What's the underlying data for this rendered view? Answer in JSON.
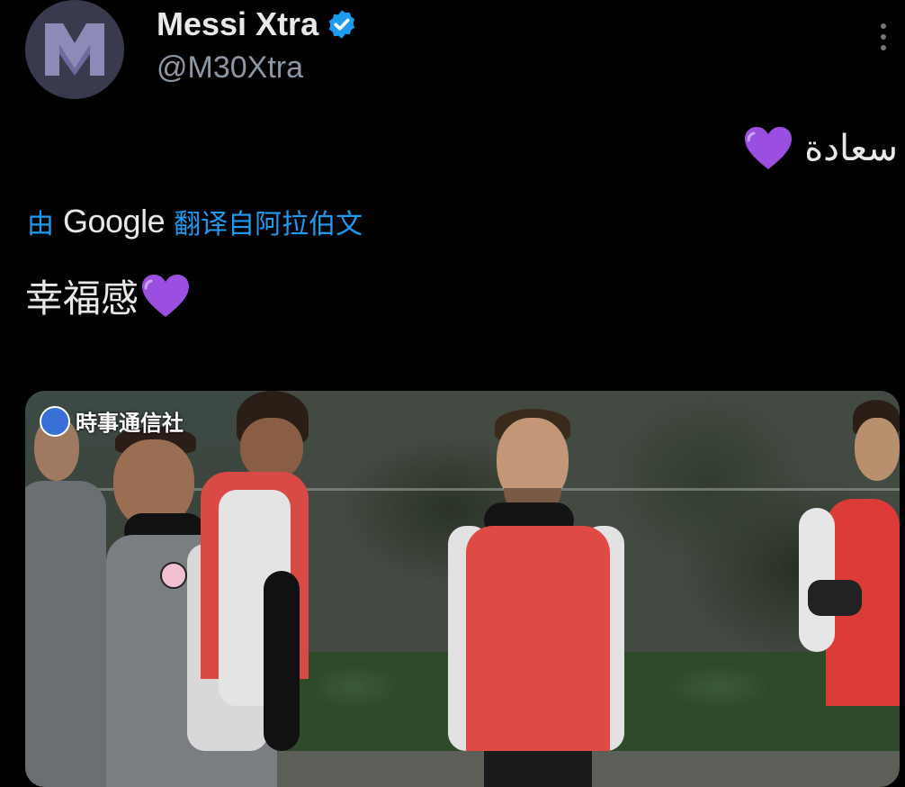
{
  "tweet": {
    "display_name": "Messi Xtra",
    "handle": "@M30Xtra",
    "original_text": "سعادة",
    "translate_prefix": "由",
    "translate_brand": "Google",
    "translate_suffix": "翻译自阿拉伯文",
    "translated_text": "幸福感",
    "icons": {
      "avatar": "m-logo-avatar",
      "verified": "verified-badge-icon",
      "heart": "purple-heart-emoji",
      "more": "more-options-icon"
    },
    "colors": {
      "background": "#000000",
      "link": "#1d9bf0",
      "verified": "#1d9bf0",
      "heart": "#9b4fe0",
      "secondary_text": "#8b98a5"
    }
  },
  "media": {
    "watermark": "時事通信社"
  }
}
